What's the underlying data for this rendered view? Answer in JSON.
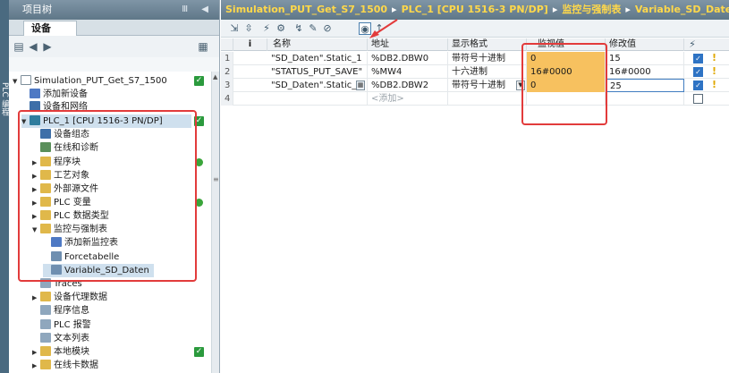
{
  "side_strip": {
    "label": "PLC 编程"
  },
  "project_tree": {
    "title": "项目树",
    "title_buttons": "Ⅲ ◀",
    "tab": "设备",
    "items": [
      {
        "label": "Simulation_PUT_Get_S7_1500",
        "status": "check"
      },
      {
        "label": "添加新设备"
      },
      {
        "label": "设备和网络"
      },
      {
        "label": "PLC_1 [CPU 1516-3 PN/DP]",
        "status": "check"
      },
      {
        "label": "设备组态"
      },
      {
        "label": "在线和诊断"
      },
      {
        "label": "程序块",
        "status": "dot"
      },
      {
        "label": "工艺对象"
      },
      {
        "label": "外部源文件"
      },
      {
        "label": "PLC 变量",
        "status": "dot"
      },
      {
        "label": "PLC 数据类型"
      },
      {
        "label": "监控与强制表"
      },
      {
        "label": "添加新监控表"
      },
      {
        "label": "Forcetabelle"
      },
      {
        "label": "Variable_SD_Daten"
      },
      {
        "label": "Traces"
      },
      {
        "label": "设备代理数据"
      },
      {
        "label": "程序信息"
      },
      {
        "label": "PLC 报警"
      },
      {
        "label": "文本列表"
      },
      {
        "label": "本地模块",
        "status": "check"
      },
      {
        "label": "在线卡数据"
      }
    ]
  },
  "breadcrumb": [
    "Simulation_PUT_Get_S7_1500",
    "PLC_1 [CPU 1516-3 PN/DP]",
    "监控与强制表",
    "Variable_SD_Daten"
  ],
  "table": {
    "headers": {
      "info": "i",
      "name": "名称",
      "address": "地址",
      "format": "显示格式",
      "monitor": "监视值",
      "modify": "修改值"
    },
    "rows": [
      {
        "no": "1",
        "name": "\"SD_Daten\".Static_1",
        "address": "%DB2.DBW0",
        "format": "带符号十进制",
        "monitor": "0",
        "modify": "15"
      },
      {
        "no": "2",
        "name": "\"STATUS_PUT_SAVE\"",
        "address": "%MW4",
        "format": "十六进制",
        "monitor": "16#0000",
        "modify": "16#0000"
      },
      {
        "no": "3",
        "name": "\"SD_Daten\".Static_2",
        "address": "%DB2.DBW2",
        "format": "带符号十进制",
        "monitor": "0",
        "modify": "25"
      },
      {
        "no": "4",
        "name": "",
        "address": "<添加>",
        "format": "",
        "monitor": "",
        "modify": ""
      }
    ]
  },
  "colors": {
    "monitor_highlight": "#f7c15f",
    "annotation_red": "#e23b3b",
    "breadcrumb_text": "#ffd84a"
  }
}
